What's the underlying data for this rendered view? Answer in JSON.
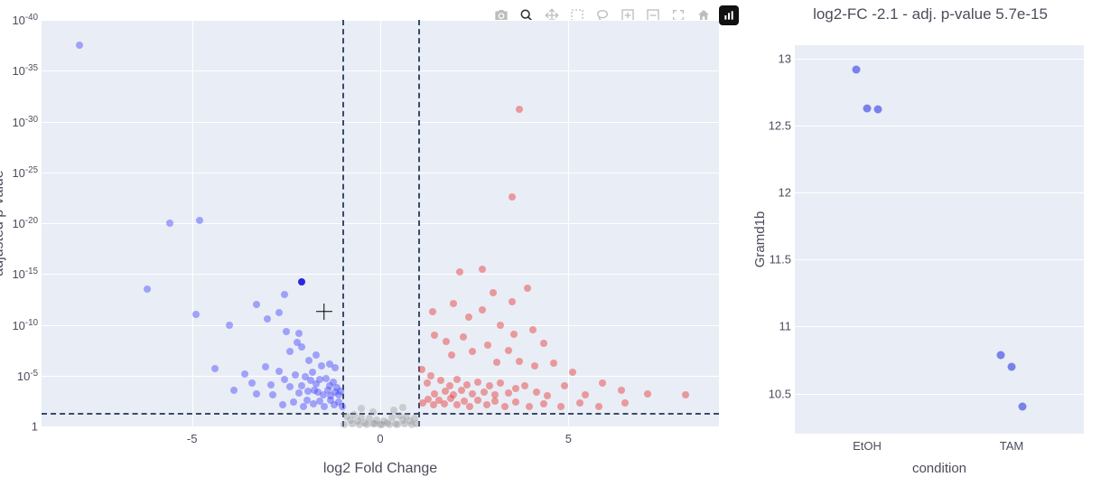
{
  "chart_data": [
    {
      "type": "scatter",
      "role": "volcano",
      "xlabel": "log2 Fold Change",
      "ylabel": "adjusted p-value",
      "xlim": [
        -9,
        9
      ],
      "y_scale": "log_inverted_pvalue",
      "y_exp_range": [
        0,
        -40
      ],
      "y_ticks_exp": [
        0,
        -5,
        -10,
        -15,
        -20,
        -25,
        -30,
        -35,
        -40
      ],
      "x_ticks": [
        -5,
        0,
        5
      ],
      "thresholds": {
        "p_adj": 0.05,
        "log2fc_neg": -1,
        "log2fc_pos": 1
      },
      "highlighted_gene": {
        "name": "Gramd1b",
        "log2fc": -2.1,
        "p_adj": 5.7e-15
      },
      "cursor_at": {
        "log2fc": -1.5,
        "neglog10p": 11.3
      },
      "series_note": "downregulated = blue (log2FC<-1 & p<0.05); upregulated = red (log2FC>1 & p<0.05); non-significant = gray. individual-point values are approximate positions read from plot.",
      "points_blue": [
        [
          -8.0,
          37.5
        ],
        [
          -5.6,
          20.0
        ],
        [
          -4.8,
          20.3
        ],
        [
          -6.2,
          13.5
        ],
        [
          -4.9,
          11.0
        ],
        [
          -4.0,
          10.0
        ],
        [
          -3.3,
          12.0
        ],
        [
          -3.0,
          10.6
        ],
        [
          -2.7,
          11.2
        ],
        [
          -2.55,
          13.0
        ],
        [
          -2.5,
          9.3
        ],
        [
          -2.2,
          8.3
        ],
        [
          -2.1,
          7.8
        ],
        [
          -4.4,
          5.7
        ],
        [
          -3.9,
          3.6
        ],
        [
          -3.6,
          5.2
        ],
        [
          -3.4,
          4.3
        ],
        [
          -3.3,
          3.2
        ],
        [
          -3.05,
          5.9
        ],
        [
          -2.9,
          4.1
        ],
        [
          -2.85,
          3.1
        ],
        [
          -2.7,
          5.4
        ],
        [
          -2.55,
          4.6
        ],
        [
          -2.4,
          3.9
        ],
        [
          -2.25,
          5.1
        ],
        [
          -2.15,
          3.3
        ],
        [
          -2.1,
          4.0
        ],
        [
          -2.0,
          4.9
        ],
        [
          -1.92,
          3.5
        ],
        [
          -1.85,
          4.5
        ],
        [
          -1.8,
          5.3
        ],
        [
          -1.75,
          3.6
        ],
        [
          -1.7,
          4.2
        ],
        [
          -1.65,
          3.4
        ],
        [
          -1.6,
          4.6
        ],
        [
          -1.52,
          3.1
        ],
        [
          -1.45,
          4.7
        ],
        [
          -1.4,
          3.6
        ],
        [
          -1.35,
          4.0
        ],
        [
          -1.32,
          3.0
        ],
        [
          -1.25,
          4.4
        ],
        [
          -1.2,
          3.4
        ],
        [
          -1.15,
          3.8
        ],
        [
          -1.1,
          3.1
        ],
        [
          -1.05,
          3.5
        ],
        [
          -2.6,
          2.1
        ],
        [
          -2.3,
          2.4
        ],
        [
          -2.05,
          2.0
        ],
        [
          -1.95,
          2.6
        ],
        [
          -1.78,
          2.2
        ],
        [
          -1.62,
          2.5
        ],
        [
          -1.48,
          2.0
        ],
        [
          -1.33,
          2.6
        ],
        [
          -1.22,
          2.1
        ],
        [
          -1.1,
          2.4
        ],
        [
          -1.02,
          2.0
        ],
        [
          -2.4,
          7.4
        ],
        [
          -2.15,
          9.2
        ],
        [
          -1.9,
          6.5
        ],
        [
          -1.7,
          7.0
        ],
        [
          -1.55,
          6.0
        ],
        [
          -1.35,
          6.1
        ],
        [
          -1.2,
          5.8
        ]
      ],
      "points_red": [
        [
          3.7,
          31.2
        ],
        [
          3.5,
          22.6
        ],
        [
          2.1,
          15.2
        ],
        [
          2.7,
          15.5
        ],
        [
          3.0,
          13.2
        ],
        [
          3.5,
          12.3
        ],
        [
          3.9,
          13.6
        ],
        [
          1.4,
          11.3
        ],
        [
          1.95,
          12.1
        ],
        [
          2.35,
          10.8
        ],
        [
          2.7,
          11.5
        ],
        [
          3.2,
          10.0
        ],
        [
          3.55,
          9.1
        ],
        [
          4.05,
          9.5
        ],
        [
          4.35,
          8.2
        ],
        [
          1.45,
          9.0
        ],
        [
          1.75,
          8.4
        ],
        [
          1.9,
          7.0
        ],
        [
          2.2,
          8.8
        ],
        [
          2.45,
          7.4
        ],
        [
          2.85,
          8.0
        ],
        [
          3.1,
          6.3
        ],
        [
          3.4,
          7.5
        ],
        [
          3.7,
          6.4
        ],
        [
          4.1,
          6.0
        ],
        [
          4.6,
          6.2
        ],
        [
          5.1,
          5.3
        ],
        [
          1.1,
          5.6
        ],
        [
          1.25,
          4.3
        ],
        [
          1.35,
          5.0
        ],
        [
          1.45,
          3.2
        ],
        [
          1.6,
          4.5
        ],
        [
          1.72,
          3.5
        ],
        [
          1.85,
          4.0
        ],
        [
          1.95,
          3.1
        ],
        [
          2.05,
          4.6
        ],
        [
          2.15,
          3.6
        ],
        [
          2.3,
          4.1
        ],
        [
          2.45,
          3.2
        ],
        [
          2.6,
          4.4
        ],
        [
          2.75,
          3.4
        ],
        [
          2.9,
          4.0
        ],
        [
          3.05,
          3.1
        ],
        [
          3.2,
          4.3
        ],
        [
          3.4,
          3.3
        ],
        [
          3.6,
          3.7
        ],
        [
          3.85,
          4.0
        ],
        [
          4.15,
          3.4
        ],
        [
          4.45,
          3.0
        ],
        [
          4.9,
          4.0
        ],
        [
          5.45,
          3.1
        ],
        [
          5.9,
          4.3
        ],
        [
          6.4,
          3.6
        ],
        [
          7.1,
          3.2
        ],
        [
          8.1,
          3.1
        ],
        [
          1.12,
          2.3
        ],
        [
          1.28,
          2.7
        ],
        [
          1.42,
          2.1
        ],
        [
          1.56,
          2.6
        ],
        [
          1.7,
          2.2
        ],
        [
          1.88,
          2.8
        ],
        [
          2.05,
          2.1
        ],
        [
          2.22,
          2.5
        ],
        [
          2.38,
          2.0
        ],
        [
          2.6,
          2.6
        ],
        [
          2.82,
          2.1
        ],
        [
          3.05,
          2.5
        ],
        [
          3.3,
          2.0
        ],
        [
          3.6,
          2.4
        ],
        [
          3.95,
          2.0
        ],
        [
          4.35,
          2.2
        ],
        [
          4.8,
          2.0
        ],
        [
          5.3,
          2.3
        ],
        [
          5.8,
          2.0
        ],
        [
          6.5,
          2.3
        ]
      ],
      "points_gray": [
        [
          -0.9,
          1.0
        ],
        [
          -0.8,
          0.6
        ],
        [
          -0.7,
          1.2
        ],
        [
          -0.6,
          0.5
        ],
        [
          -0.5,
          0.9
        ],
        [
          -0.4,
          0.4
        ],
        [
          -0.3,
          0.8
        ],
        [
          -0.2,
          0.3
        ],
        [
          -0.1,
          0.6
        ],
        [
          0.0,
          0.2
        ],
        [
          0.1,
          0.5
        ],
        [
          0.2,
          0.4
        ],
        [
          0.3,
          0.9
        ],
        [
          0.4,
          0.3
        ],
        [
          0.5,
          1.1
        ],
        [
          0.6,
          0.6
        ],
        [
          0.7,
          1.0
        ],
        [
          0.8,
          0.5
        ],
        [
          0.9,
          0.8
        ],
        [
          -0.95,
          0.2
        ],
        [
          -0.75,
          0.3
        ],
        [
          -0.55,
          0.2
        ],
        [
          -0.35,
          0.15
        ],
        [
          -0.15,
          0.25
        ],
        [
          0.05,
          0.15
        ],
        [
          0.25,
          0.2
        ],
        [
          0.45,
          0.15
        ],
        [
          0.65,
          0.25
        ],
        [
          0.85,
          0.2
        ],
        [
          0.95,
          0.3
        ],
        [
          -0.5,
          1.8
        ],
        [
          0.35,
          1.6
        ],
        [
          -0.2,
          1.4
        ],
        [
          0.6,
          1.9
        ]
      ]
    },
    {
      "type": "scatter",
      "role": "stripplot",
      "title": "log2-FC -2.1 - adj. p-value 5.7e-15",
      "xlabel": "condition",
      "ylabel": "Gramd1b",
      "categories": [
        "EtOH",
        "TAM"
      ],
      "ylim": [
        10.2,
        13.1
      ],
      "y_ticks": [
        10.5,
        11,
        11.5,
        12,
        12.5,
        13
      ],
      "points": {
        "EtOH": [
          12.92,
          12.63,
          12.62
        ],
        "TAM": [
          10.79,
          10.7,
          10.4
        ]
      }
    }
  ],
  "toolbar": {
    "buttons": [
      {
        "name": "camera-icon",
        "label": "Download plot as png"
      },
      {
        "name": "zoom-icon",
        "label": "Zoom",
        "active": true
      },
      {
        "name": "pan-icon",
        "label": "Pan"
      },
      {
        "name": "box-select-icon",
        "label": "Box Select"
      },
      {
        "name": "lasso-icon",
        "label": "Lasso Select"
      },
      {
        "name": "zoom-in-icon",
        "label": "Zoom in"
      },
      {
        "name": "zoom-out-icon",
        "label": "Zoom out"
      },
      {
        "name": "autoscale-icon",
        "label": "Autoscale"
      },
      {
        "name": "reset-icon",
        "label": "Reset axes"
      },
      {
        "name": "plotly-logo",
        "label": "Produced with Plotly"
      }
    ]
  }
}
